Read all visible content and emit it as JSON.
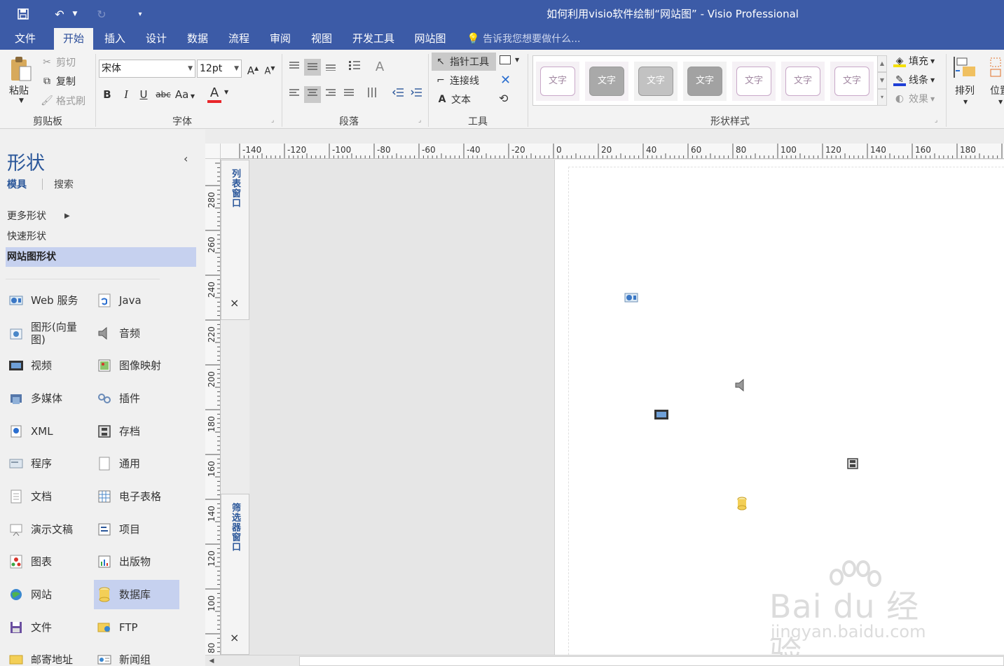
{
  "app": {
    "title": "如何利用visio软件绘制“网站图” - Visio Professional",
    "accent": "#3c5ba7"
  },
  "menu": {
    "tabs": [
      "文件",
      "开始",
      "插入",
      "设计",
      "数据",
      "流程",
      "审阅",
      "视图",
      "开发工具",
      "网站图"
    ],
    "active": "开始",
    "tell_me": "告诉我您想要做什么..."
  },
  "ribbon": {
    "clipboard": {
      "label": "剪贴板",
      "paste": "粘贴",
      "cut": "剪切",
      "copy": "复制",
      "format_painter": "格式刷"
    },
    "font": {
      "label": "字体",
      "font_name": "宋体",
      "font_size": "12pt",
      "bold": "B",
      "italic": "I",
      "underline": "U",
      "strike": "abc",
      "case": "Aa",
      "grow": "A",
      "shrink": "A",
      "color": "A"
    },
    "paragraph": {
      "label": "段落"
    },
    "tools": {
      "label": "工具",
      "pointer": "指针工具",
      "connector": "连接线",
      "text": "文本"
    },
    "shape_styles": {
      "label": "形状样式",
      "style_text": "文字",
      "fill": "填充",
      "line": "线条",
      "effects": "效果"
    },
    "arrange": {
      "label": "排列",
      "position": "位置"
    }
  },
  "shapes_pane": {
    "title": "形状",
    "tabs": [
      "模具",
      "搜索"
    ],
    "stencils": [
      "更多形状",
      "快速形状",
      "网站图形状"
    ],
    "active_stencil": "网站图形状",
    "items_left": [
      "Web 服务",
      "图形(向量图)",
      "视频",
      "多媒体",
      "XML",
      "程序",
      "文档",
      "演示文稿",
      "图表",
      "网站",
      "文件",
      "邮寄地址"
    ],
    "items_right": [
      "Java",
      "音频",
      "图像映射",
      "插件",
      "存档",
      "通用",
      "电子表格",
      "项目",
      "出版物",
      "数据库",
      "FTP",
      "新闻组"
    ],
    "active_item": "数据库"
  },
  "windows": {
    "list_window": "列表窗口",
    "filter_window": "筛选器窗口",
    "close": "×"
  },
  "rulers": {
    "horizontal": [
      "-140",
      "-120",
      "-100",
      "-80",
      "-60",
      "-40",
      "-20",
      "0",
      "20",
      "40",
      "60",
      "80",
      "100",
      "120",
      "140",
      "160",
      "180"
    ],
    "vertical": [
      "280",
      "260",
      "240",
      "220",
      "200",
      "180",
      "160",
      "140",
      "120",
      "100",
      "80"
    ]
  },
  "watermark": {
    "main": "Bai du 经验",
    "sub": "jingyan.baidu.com"
  }
}
